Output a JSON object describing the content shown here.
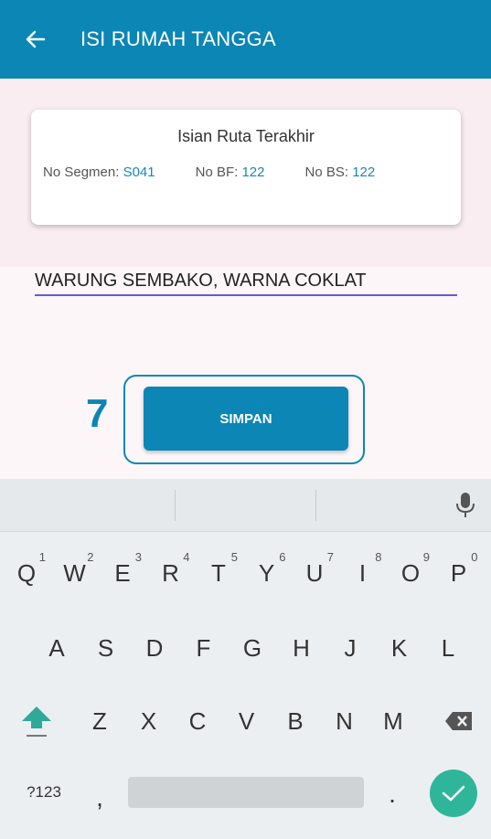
{
  "appbar": {
    "title": "ISI RUMAH TANGGA",
    "back_icon": "arrow-left-icon",
    "color": "#0b86b5"
  },
  "card": {
    "title": "Isian Ruta Terakhir",
    "segmen_label": "No Segmen:",
    "segmen_value": "S041",
    "bf_label": "No BF:",
    "bf_value": "122",
    "bs_label": "No BS:",
    "bs_value": "122"
  },
  "input": {
    "value": "WARUNG SEMBAKO, WARNA COKLAT"
  },
  "step": {
    "number": "7"
  },
  "button": {
    "simpan_label": "SIMPAN"
  },
  "keyboard": {
    "row1": [
      {
        "k": "Q",
        "h": "1"
      },
      {
        "k": "W",
        "h": "2"
      },
      {
        "k": "E",
        "h": "3"
      },
      {
        "k": "R",
        "h": "4"
      },
      {
        "k": "T",
        "h": "5"
      },
      {
        "k": "Y",
        "h": "6"
      },
      {
        "k": "U",
        "h": "7"
      },
      {
        "k": "I",
        "h": "8"
      },
      {
        "k": "O",
        "h": "9"
      },
      {
        "k": "P",
        "h": "0"
      }
    ],
    "row2": [
      "A",
      "S",
      "D",
      "F",
      "G",
      "H",
      "J",
      "K",
      "L"
    ],
    "row3": [
      "Z",
      "X",
      "C",
      "V",
      "B",
      "N",
      "M"
    ],
    "symbols_label": "?123",
    "comma": ",",
    "period": ".",
    "mic_icon": "microphone-icon",
    "shift_icon": "shift-icon",
    "backspace_icon": "backspace-icon",
    "enter_icon": "check-icon",
    "enter_color": "#2fb69a"
  }
}
